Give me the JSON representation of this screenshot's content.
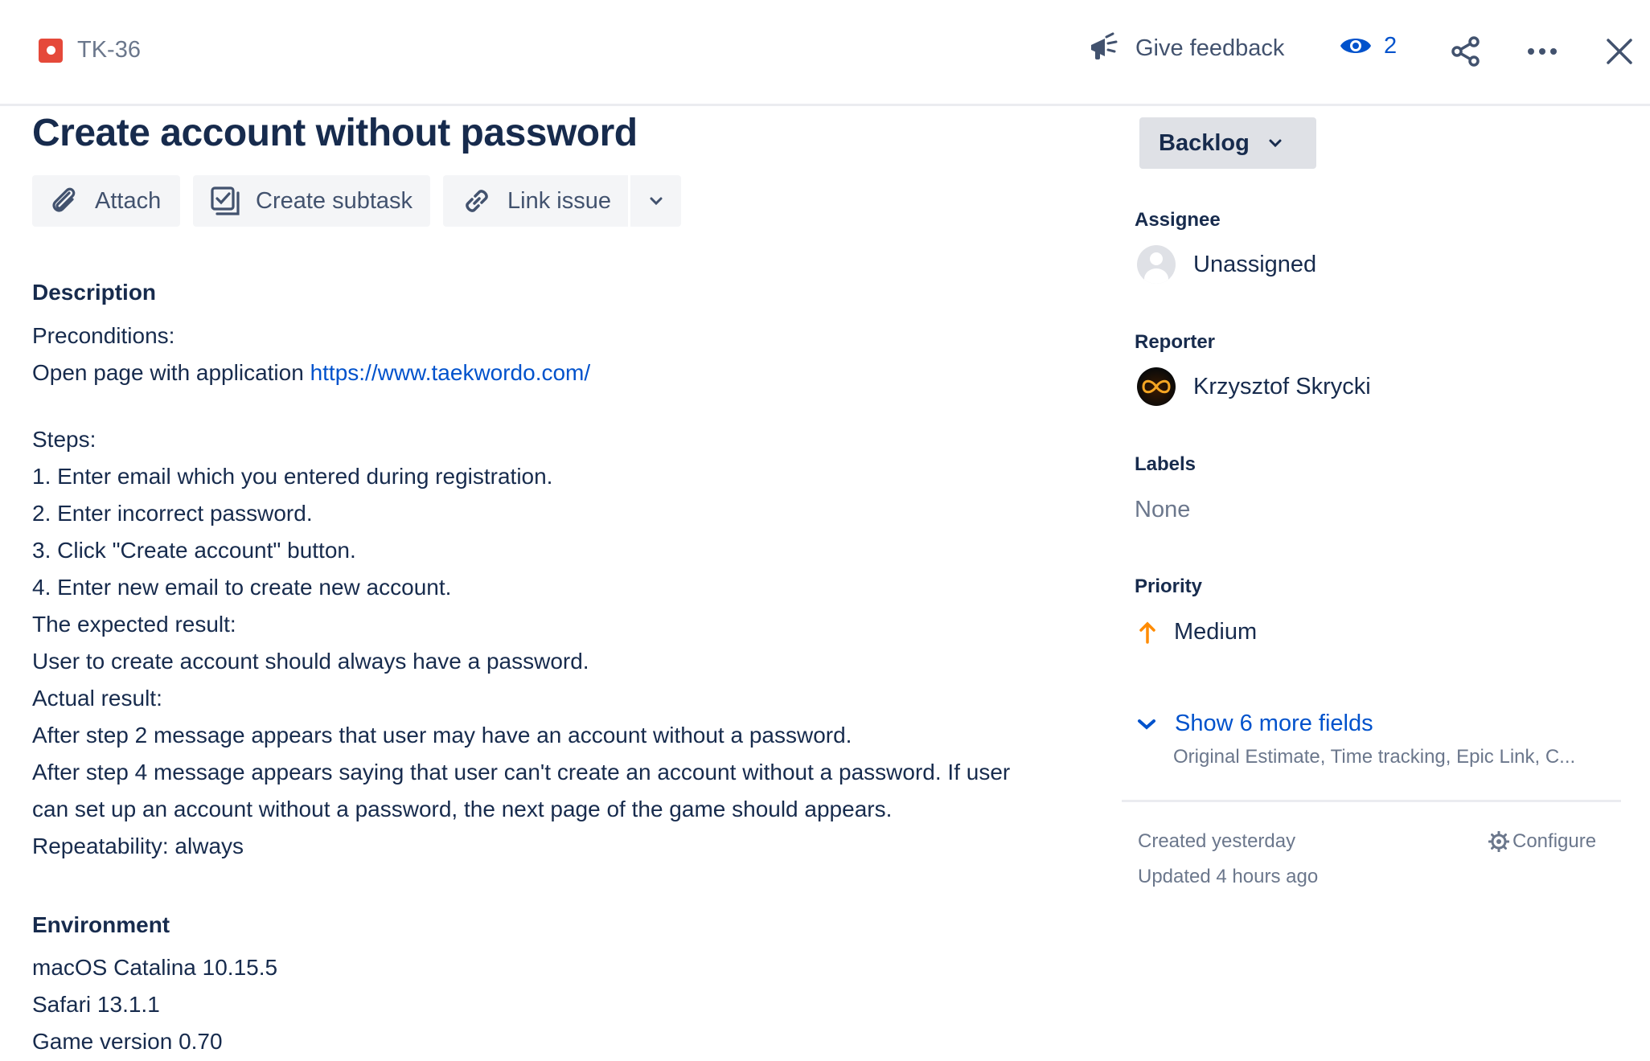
{
  "header": {
    "issue_key": "TK-36",
    "feedback_label": "Give feedback",
    "watch_count": "2"
  },
  "issue": {
    "title": "Create account without password"
  },
  "actions": {
    "attach": "Attach",
    "create_subtask": "Create subtask",
    "link_issue": "Link issue"
  },
  "description": {
    "heading": "Description",
    "preconditions_label": "Preconditions:",
    "open_page_prefix": "Open page with application ",
    "url": "https://www.taekwordo.com/",
    "steps_label": "Steps:",
    "steps": [
      "1. Enter email which you entered during registration.",
      "2. Enter incorrect password.",
      "3. Click \"Create account\" button.",
      "4. Enter new email to create new account."
    ],
    "expected_label": "The expected result:",
    "expected_text": "User to create account should always have a password.",
    "actual_label": "Actual result:",
    "actual_lines": [
      "After step 2 message appears that user may have an account without a password.",
      "After step 4 message appears saying that user can't create an account without a password. If user",
      "can set up an account without a password, the next page of the game should appears."
    ],
    "repeatability": "Repeatability: always"
  },
  "environment": {
    "heading": "Environment",
    "lines": [
      "macOS Catalina 10.15.5",
      "Safari 13.1.1",
      "Game version 0.70"
    ]
  },
  "sidebar": {
    "status": "Backlog",
    "assignee_label": "Assignee",
    "assignee_value": "Unassigned",
    "reporter_label": "Reporter",
    "reporter_value": "Krzysztof Skrycki",
    "labels_label": "Labels",
    "labels_value": "None",
    "priority_label": "Priority",
    "priority_value": "Medium",
    "priority_color": "#ff8b00",
    "show_more": "Show 6 more fields",
    "show_more_sub": "Original Estimate, Time tracking, Epic Link, C...",
    "created": "Created yesterday",
    "updated": "Updated 4 hours ago",
    "configure": "Configure"
  },
  "colors": {
    "link": "#0052cc",
    "bug": "#e5493a",
    "text": "#172b4d",
    "muted": "#6b778c"
  },
  "icons": [
    "bug-icon",
    "megaphone-icon",
    "eye-icon",
    "share-icon",
    "more-icon",
    "close-icon",
    "paperclip-icon",
    "subtask-icon",
    "link-icon",
    "chevron-down-icon",
    "user-icon",
    "arrow-up-icon",
    "gear-icon"
  ]
}
